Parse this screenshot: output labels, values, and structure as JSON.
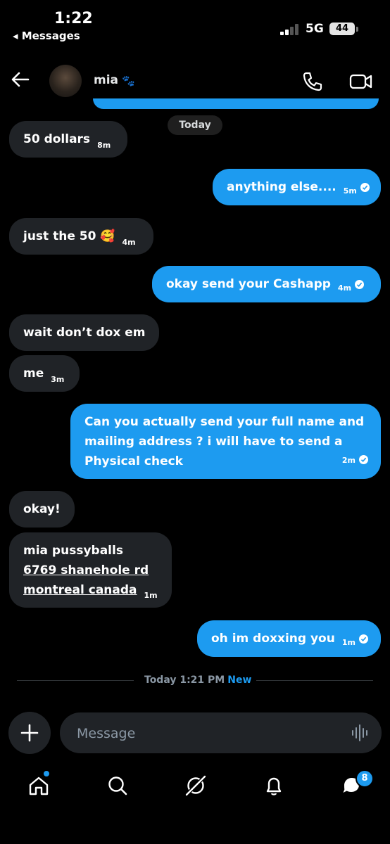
{
  "status": {
    "time": "1:22",
    "back_app": "◂ Messages",
    "network": "5G",
    "battery": "44"
  },
  "header": {
    "contact_name": "mia",
    "paw": "🐾"
  },
  "date_pill": "Today",
  "messages": [
    {
      "dir": "in",
      "text": "50 dollars",
      "time": "8m"
    },
    {
      "dir": "out",
      "text": "anything else....",
      "time": "5m"
    },
    {
      "dir": "in",
      "text": "just the 50 🥰",
      "time": "4m"
    },
    {
      "dir": "out",
      "text": "okay send your Cashapp",
      "time": "4m"
    },
    {
      "dir": "in",
      "text": "wait don’t dox em",
      "time": ""
    },
    {
      "dir": "in",
      "text": "me",
      "time": "3m"
    },
    {
      "dir": "out",
      "lines": [
        "Can you actually send your full name and",
        "mailing address ? i will have to send a",
        "Physical check"
      ],
      "time": "2m"
    },
    {
      "dir": "in",
      "text": "okay!",
      "time": ""
    },
    {
      "dir": "in",
      "lines": [
        "mia pussyballs",
        "6769 shanehole rd",
        "montreal canada"
      ],
      "time": "1m"
    },
    {
      "dir": "out",
      "text": "oh im doxxing you",
      "time": "1m"
    }
  ],
  "new_divider": {
    "label": "Today 1:21 PM",
    "new": "New"
  },
  "compose": {
    "placeholder": "Message"
  },
  "tabbar": {
    "messages_badge": "8"
  },
  "icons": [
    "back-arrow-icon",
    "phone-icon",
    "video-icon",
    "plus-icon",
    "voice-wave-icon",
    "home-icon",
    "search-icon",
    "grok-icon",
    "bell-icon",
    "messages-icon"
  ],
  "colors": {
    "accent": "#1d9bf0",
    "incoming_bubble": "#202327",
    "background": "#000000"
  }
}
